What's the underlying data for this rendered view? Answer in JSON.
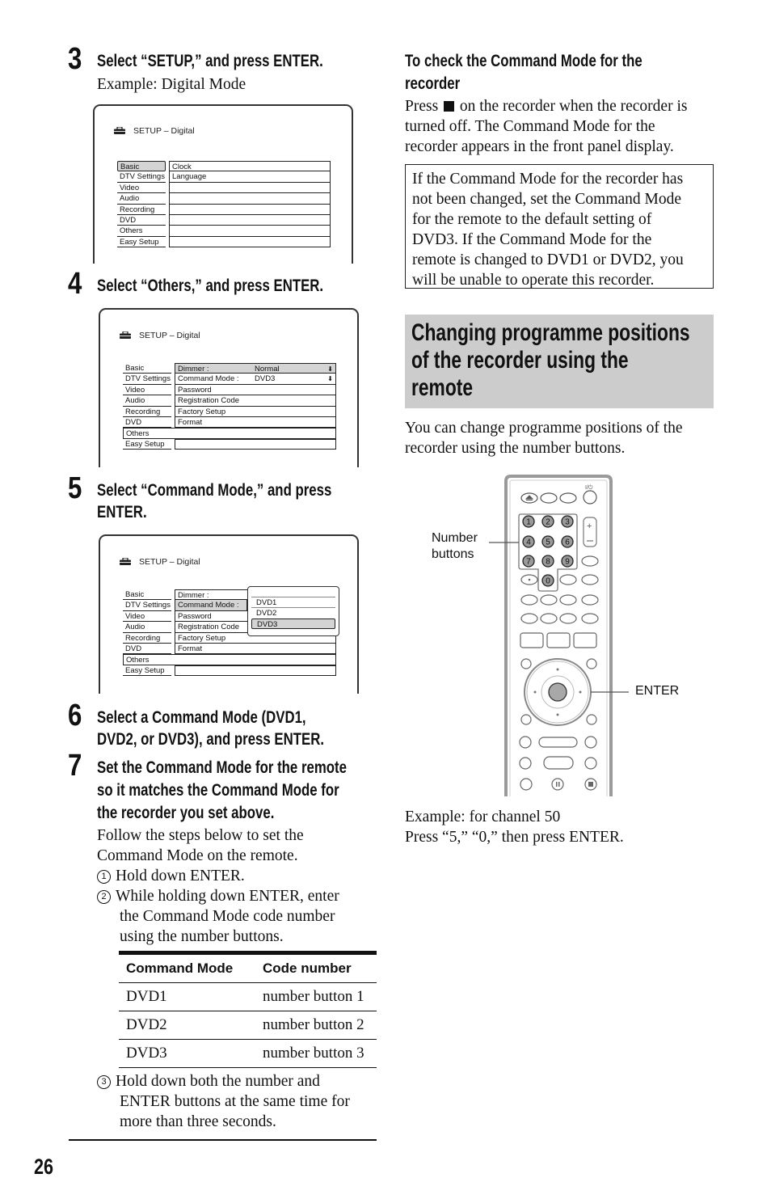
{
  "page_number": "26",
  "left_column": {
    "step3": {
      "number": "3",
      "heading": "Select “SETUP,” and press ENTER.",
      "subtext": "Example: Digital Mode",
      "screen": {
        "title": "SETUP – Digital",
        "left_menu": [
          "Basic",
          "DTV Settings",
          "Video",
          "Audio",
          "Recording",
          "DVD",
          "Others",
          "Easy Setup"
        ],
        "selected_left": "Basic",
        "right_items": [
          "Clock",
          "Language",
          "",
          "",
          "",
          "",
          "",
          ""
        ]
      }
    },
    "step4": {
      "number": "4",
      "heading": "Select “Others,” and press ENTER.",
      "screen": {
        "title": "SETUP – Digital",
        "left_menu": [
          "Basic",
          "DTV Settings",
          "Video",
          "Audio",
          "Recording",
          "DVD",
          "Others",
          "Easy Setup"
        ],
        "selected_left": "Others",
        "right_items": [
          {
            "label": "Dimmer :",
            "value": "Normal"
          },
          {
            "label": "Command Mode :",
            "value": "DVD3"
          },
          {
            "label": "Password",
            "value": ""
          },
          {
            "label": "Registration Code",
            "value": ""
          },
          {
            "label": "Factory Setup",
            "value": ""
          },
          {
            "label": "Format",
            "value": ""
          }
        ],
        "highlighted_right": "Dimmer :"
      }
    },
    "step5": {
      "number": "5",
      "heading_line1": "Select “Command Mode,” and press",
      "heading_line2": "ENTER.",
      "screen": {
        "title": "SETUP – Digital",
        "left_menu": [
          "Basic",
          "DTV Settings",
          "Video",
          "Audio",
          "Recording",
          "DVD",
          "Others",
          "Easy Setup"
        ],
        "right_items": [
          "Dimmer :",
          "Command Mode :",
          "Password",
          "Registration Code",
          "Factory Setup",
          "Format"
        ],
        "highlighted_right": "Command Mode :",
        "popup_options": [
          "DVD1",
          "DVD2",
          "DVD3"
        ],
        "popup_selected": "DVD3"
      }
    },
    "step6": {
      "number": "6",
      "heading_line1": "Select a Command Mode (DVD1,",
      "heading_line2": "DVD2, or DVD3), and press ENTER."
    },
    "step7": {
      "number": "7",
      "heading_line1": "Set the Command Mode for the remote",
      "heading_line2": "so it matches the Command Mode for",
      "heading_line3": "the recorder you set above.",
      "intro_line1": "Follow the steps below to set the",
      "intro_line2": "Command Mode on the remote.",
      "substeps": [
        {
          "marker": "1",
          "lines": [
            "Hold down ENTER."
          ]
        },
        {
          "marker": "2",
          "lines": [
            "While holding down ENTER, enter",
            "the Command Mode code number",
            "using the number buttons."
          ]
        },
        {
          "marker": "3",
          "lines": [
            "Hold down both the number and",
            "ENTER buttons at the same time for",
            "more than three seconds."
          ]
        }
      ],
      "table": {
        "headers": [
          "Command Mode",
          "Code number"
        ],
        "rows": [
          [
            "DVD1",
            "number button 1"
          ],
          [
            "DVD2",
            "number button 2"
          ],
          [
            "DVD3",
            "number button 3"
          ]
        ]
      }
    }
  },
  "right_column": {
    "check_heading_line1": "To check the Command Mode for the",
    "check_heading_line2": "recorder",
    "check_text": [
      "Press",
      "on the recorder when the recorder is",
      "turned off. The Command Mode for the",
      "recorder appears in the front panel display."
    ],
    "stop_icon": "stop-square-icon",
    "note_lines": [
      "If the Command Mode for the recorder has",
      "not been changed, set the Command Mode",
      "for the remote to the default setting of",
      "DVD3. If the Command Mode for the",
      "remote is changed to DVD1 or DVD2, you",
      "will be unable to operate this recorder."
    ],
    "section_title_lines": [
      "Changing programme positions",
      "of the recorder using the",
      "remote"
    ],
    "section_intro": [
      "You can change programme positions of the",
      "recorder using the number buttons."
    ],
    "remote_labels": {
      "number_buttons_line1": "Number",
      "number_buttons_line2": "buttons",
      "enter": "ENTER",
      "power_symbol": "I/⏻"
    },
    "number_keys": [
      "1",
      "2",
      "3",
      "4",
      "5",
      "6",
      "7",
      "8",
      "9",
      "0"
    ],
    "example_line1": "Example: for channel 50",
    "example_line2": "Press “5,” “0,” then press ENTER."
  },
  "colors": {
    "section_band": "#cccccc",
    "highlight": "#d4d4d4",
    "key_fill": "#9a9a9a"
  }
}
